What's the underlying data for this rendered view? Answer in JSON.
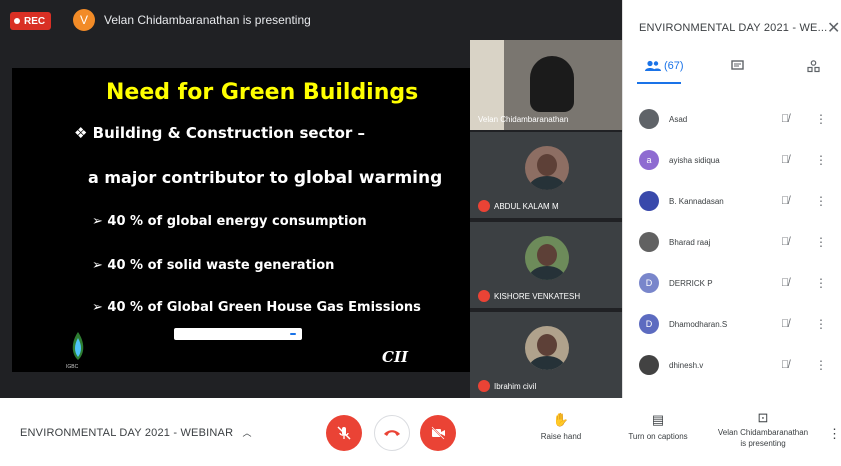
{
  "topbar": {
    "rec_label": "REC",
    "presenter_initial": "V",
    "presenting_text": "Velan Chidambaranathan is presenting"
  },
  "slide": {
    "title": "Need for Green Buildings",
    "bullet_main_1": "❖ Building & Construction sector –",
    "bullet_main_2a": "a major contributor to",
    "bullet_main_2b": "global warming",
    "sub_1": "➢ 40 % of global energy consumption",
    "sub_2": "➢ 40 % of solid waste generation",
    "sub_3": "➢ 40 % of Global Green House Gas Emissions",
    "logo_left_label": "IGBC",
    "logo_right_label": "CII"
  },
  "tiles": [
    {
      "name": "Velan Chidambaranathan"
    },
    {
      "name": "ABDUL KALAM M"
    },
    {
      "name": "KISHORE VENKATESH"
    },
    {
      "name": "Ibrahim civil"
    }
  ],
  "panel": {
    "title": "ENVIRONMENTAL DAY 2021 - WE...",
    "close_glyph": "✕",
    "people_count": "(67)",
    "participants": [
      {
        "name": "Asad",
        "initial": "",
        "color": "#5f6368"
      },
      {
        "name": "ayisha sidiqua",
        "initial": "a",
        "color": "#8e6bd1"
      },
      {
        "name": "B. Kannadasan",
        "initial": "",
        "color": "#3949ab"
      },
      {
        "name": "Bharad raaj",
        "initial": "",
        "color": "#616161"
      },
      {
        "name": "DERRICK P",
        "initial": "D",
        "color": "#7986cb"
      },
      {
        "name": "Dhamodharan.S",
        "initial": "D",
        "color": "#5c6bc0"
      },
      {
        "name": "dhinesh.v",
        "initial": "",
        "color": "#424242"
      }
    ]
  },
  "bottom": {
    "meeting_title": "ENVIRONMENTAL DAY 2021 - WEBINAR",
    "raise_hand": "Raise hand",
    "captions": "Turn on captions",
    "presenting_line1": "Velan Chidambaranathan",
    "presenting_line2": "is presenting"
  }
}
